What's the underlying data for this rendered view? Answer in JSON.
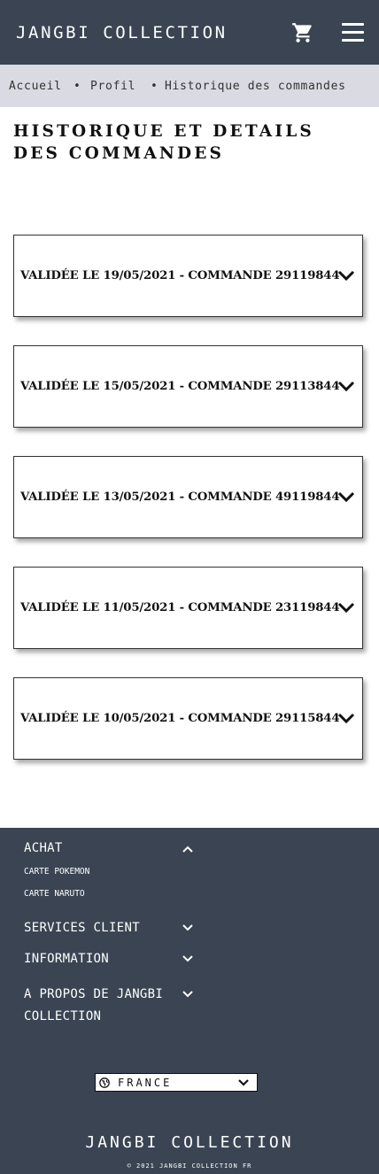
{
  "header": {
    "brand": "JANGBI COLLECTION",
    "cart_icon": "shopping-cart-icon",
    "menu_icon": "hamburger-menu-icon"
  },
  "breadcrumb": {
    "items": [
      "Accueil",
      "Profil",
      "Historique des commandes"
    ],
    "separator": "•"
  },
  "page": {
    "title": "HISTORIQUE ET DETAILS DES COMMANDES"
  },
  "orders": [
    {
      "label": "VALIDÉE LE 19/05/2021 - COMMANDE 29119844"
    },
    {
      "label": "VALIDÉE LE 15/05/2021 - COMMANDE 29113844"
    },
    {
      "label": "VALIDÉE LE 13/05/2021 - COMMANDE 49119844"
    },
    {
      "label": "VALIDÉE LE 11/05/2021 - COMMANDE 23119844"
    },
    {
      "label": "VALIDÉE LE 10/05/2021 - COMMANDE 29115844"
    }
  ],
  "footer": {
    "sections": [
      {
        "title": "ACHAT",
        "expanded": true,
        "items": [
          "CARTE POKEMON",
          "CARTE NARUTO"
        ]
      },
      {
        "title": "SERVICES CLIENT",
        "expanded": false
      },
      {
        "title": "INFORMATION",
        "expanded": false
      },
      {
        "title": "A PROPOS DE JANGBI COLLECTION",
        "expanded": false
      }
    ],
    "language": {
      "selected": "FRANCE",
      "icon": "globe-icon"
    },
    "brand": "JANGBI COLLECTION",
    "copyright": "© 2021 JANGBI COLLECTION FR"
  },
  "colors": {
    "header_bg": "#3a4453",
    "breadcrumb_bg": "#dadae2",
    "footer_bg": "#3a4453"
  }
}
